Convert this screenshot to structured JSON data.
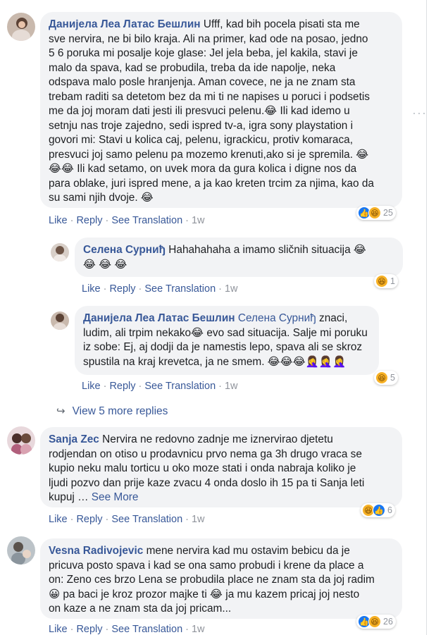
{
  "comments": [
    {
      "author": "Данијела Леа Латас Бешлин",
      "text_lines": [
        "Ufff, kad bih pocela pisati sta me",
        "sve nervira, ne bi bilo kraja. Ali na primer, kad ode na posao, jedno",
        "5 6 poruka mi posalje koje glase: Jel jela beba, jel kakila, stavi je",
        "malo da spava, kad se probudila, treba da ide napolje, neka",
        "odspava malo posle hranjenja. Aman covece, ne ja ne znam sta",
        "trebam raditi sa detetom bez da mi ti ne napises u poruci i podsetis",
        "me da joj moram dati jesti ili presvuci pelenu.😂 Ili kad idemo u",
        "setnju nas troje zajedno, sedi ispred tv-a, igra sony playstation i",
        "govori mi: Stavi u kolica caj, pelenu, igrackicu, protiv komaraca,",
        "presvuci joj samo pelenu pa mozemo krenuti,ako si je spremila. 😂",
        "😂😂 Ili kad setamo, on uvek mora da gura kolica i digne nos da",
        "para oblake, juri ispred mene, a ja kao kreten trcim za njima, kao da",
        "su sami njih dvoje. 😂"
      ],
      "actions": {
        "like": "Like",
        "reply": "Reply",
        "translate": "See Translation",
        "time": "1w"
      },
      "reaction_count": "25"
    },
    {
      "author": "Селена Сурниђ",
      "text_lines": [
        "Hahahahaha a imamo sličnih situacija 😂",
        "😂 😂 😂"
      ],
      "actions": {
        "like": "Like",
        "reply": "Reply",
        "translate": "See Translation",
        "time": "1w"
      },
      "reaction_count": "1"
    },
    {
      "author": "Данијела Леа Латас Бешлин",
      "mention": "Селена Сурниђ",
      "text_lines": [
        " znaci,",
        "ludim, ali trpim nekako😂 evo sad situacija. Salje mi poruku",
        "iz sobe: Ej, aj dodji da je namestis lepo, spava ali se skroz",
        "spustila na kraj krevetca, ja ne smem. 😂😂😂🤦‍♀️🤦‍♀️🤦‍♀️"
      ],
      "actions": {
        "like": "Like",
        "reply": "Reply",
        "translate": "See Translation",
        "time": "1w"
      },
      "reaction_count": "5"
    },
    {
      "author": "Sanja Zec",
      "text_lines": [
        "Nervira ne redovno zadnje me iznervirao djetetu",
        "rodjendan on otiso u prodavnicu prvo nema ga 3h drugo vraca se",
        "kupio neku malu torticu u oko moze stati i onda nabraja koliko je",
        "ljudi pozvo dan prije kaze zvacu 4 onda doslo ih 15 pa ti Sanja leti",
        "kupuj … "
      ],
      "see_more": "See More",
      "actions": {
        "like": "Like",
        "reply": "Reply",
        "translate": "See Translation",
        "time": "1w"
      },
      "reaction_count": "6"
    },
    {
      "author": "Vesna Radivojevic",
      "text_lines": [
        "mene nervira kad mu ostavim bebicu da je",
        "pricuva posto spava i kad se ona samo probudi i krene da place a",
        "on: Zeno ces brzo Lena se probudila place ne znam sta da joj radim",
        "😀 pa baci je kroz prozor majke ti 😂 ja mu kazem pricaj joj nesto",
        "on kaze a ne znam sta da joj pricam..."
      ],
      "actions": {
        "like": "Like",
        "reply": "Reply",
        "translate": "See Translation",
        "time": "1w"
      },
      "reaction_count": "26"
    }
  ],
  "view_more": "View 5 more replies",
  "icons": {
    "like": "like-reaction-icon",
    "haha": "haha-reaction-icon",
    "reply_arrow": "reply-arrow-icon",
    "more": "more-options-icon"
  },
  "colors": {
    "link": "#385898",
    "bubble": "#f2f3f5",
    "like": "#1877f2",
    "haha": "#f7b125"
  }
}
